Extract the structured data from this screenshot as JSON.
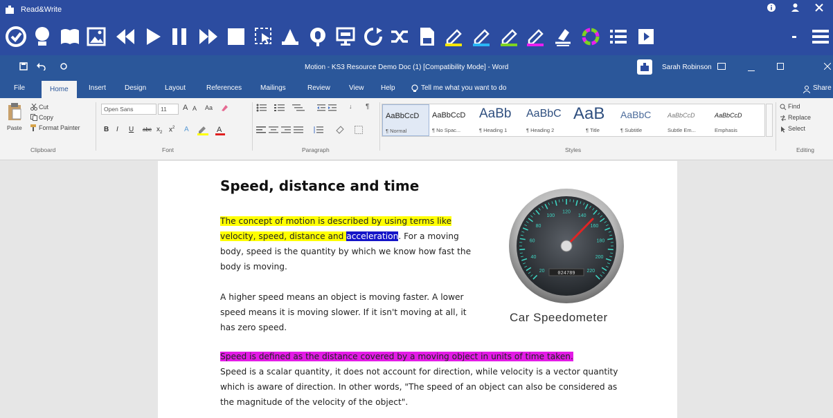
{
  "readwrite": {
    "title": "Read&Write",
    "tools": [
      "check-it",
      "prediction",
      "dictionary",
      "picture-dictionary",
      "rewind",
      "play",
      "pause",
      "forward",
      "stop",
      "screenshot-reader",
      "audio-maker",
      "speech-input",
      "screen-mask",
      "talk-and-type",
      "vocabulary",
      "web-search",
      "highlight-yellow",
      "highlight-blue",
      "highlight-green",
      "highlight-pink",
      "clear-highlights",
      "collect-highlights",
      "vocabulary-list",
      "practice-reading"
    ]
  },
  "word": {
    "doc_title": "Motion - KS3 Resource Demo Doc (1) [Compatibility Mode] - Word",
    "user": "Sarah Robinson",
    "tabs": [
      "File",
      "Home",
      "Insert",
      "Design",
      "Layout",
      "References",
      "Mailings",
      "Review",
      "View",
      "Help"
    ],
    "tell_me": "Tell me what you want to do",
    "share": "Share"
  },
  "ribbon": {
    "clipboard": {
      "paste": "Paste",
      "cut": "Cut",
      "copy": "Copy",
      "format_painter": "Format Painter",
      "label": "Clipboard"
    },
    "font": {
      "name": "Open Sans",
      "size": "11",
      "label": "Font"
    },
    "paragraph": {
      "label": "Paragraph"
    },
    "styles": {
      "label": "Styles",
      "items": [
        {
          "preview": "AaBbCcD",
          "name": "¶ Normal"
        },
        {
          "preview": "AaBbCcD",
          "name": "¶ No Spac..."
        },
        {
          "preview": "AaBb",
          "name": "¶ Heading 1"
        },
        {
          "preview": "AaBbC",
          "name": "¶ Heading 2"
        },
        {
          "preview": "AaB",
          "name": "¶ Title"
        },
        {
          "preview": "AaBbC",
          "name": "¶ Subtitle"
        },
        {
          "preview": "AaBbCcD",
          "name": "Subtle Em..."
        },
        {
          "preview": "AaBbCcD",
          "name": "Emphasis"
        }
      ]
    },
    "editing": {
      "find": "Find",
      "replace": "Replace",
      "select": "Select",
      "label": "Editing"
    }
  },
  "document": {
    "title": "Speed, distance and time",
    "p1": {
      "hl_yellow": "The concept of motion is described by using terms like velocity, speed, distance and ",
      "hl_blue": "acceleration",
      "rest": ". For a moving body, speed is the quantity by which we know how fast the body is moving."
    },
    "p2": "A higher speed means an object is moving faster. A lower speed means it is moving slower. If it isn't moving at all, it has zero speed.",
    "p3": {
      "hl_magenta": "Speed is defined as the distance covered by a moving object in units of time taken.",
      "rest": "Speed is a scalar quantity, it does not account for direction, while velocity is a vector quantity which is aware of direction. In other words, \"The speed of an object can also be considered as the magnitude of the velocity of the object\"."
    },
    "image_caption": "Car Speedometer",
    "speedo_ticks": [
      "20",
      "40",
      "60",
      "80",
      "100",
      "120",
      "140",
      "160",
      "180",
      "200",
      "220"
    ],
    "odometer": "024789"
  }
}
